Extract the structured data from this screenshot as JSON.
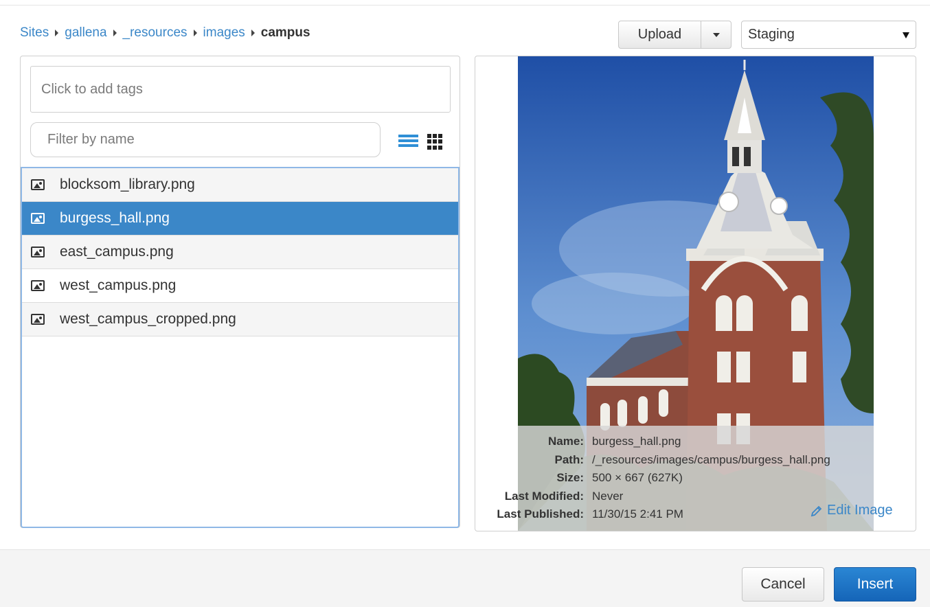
{
  "breadcrumb": {
    "items": [
      "Sites",
      "gallena",
      "_resources",
      "images"
    ],
    "current": "campus"
  },
  "toolbar": {
    "upload_label": "Upload",
    "environment_selected": "Staging"
  },
  "filters": {
    "tags_placeholder": "Click to add tags",
    "name_placeholder": "Filter by name",
    "view_list_icon": "list-view-icon",
    "view_grid_icon": "grid-view-icon"
  },
  "files": [
    {
      "name": "blocksom_library.png",
      "selected": false
    },
    {
      "name": "burgess_hall.png",
      "selected": true
    },
    {
      "name": "east_campus.png",
      "selected": false
    },
    {
      "name": "west_campus.png",
      "selected": false
    },
    {
      "name": "west_campus_cropped.png",
      "selected": false
    }
  ],
  "preview": {
    "labels": {
      "name": "Name:",
      "path": "Path:",
      "size": "Size:",
      "last_modified": "Last Modified:",
      "last_published": "Last Published:"
    },
    "values": {
      "name": "burgess_hall.png",
      "path": "/_resources/images/campus/burgess_hall.png",
      "size": "500 × 667 (627K)",
      "last_modified": "Never",
      "last_published": "11/30/15 2:41 PM"
    },
    "edit_label": "Edit Image"
  },
  "footer": {
    "cancel_label": "Cancel",
    "insert_label": "Insert"
  },
  "colors": {
    "accent": "#3b87c8",
    "primary_button": "#1a6fc2",
    "selected_row": "#3b87c8"
  }
}
